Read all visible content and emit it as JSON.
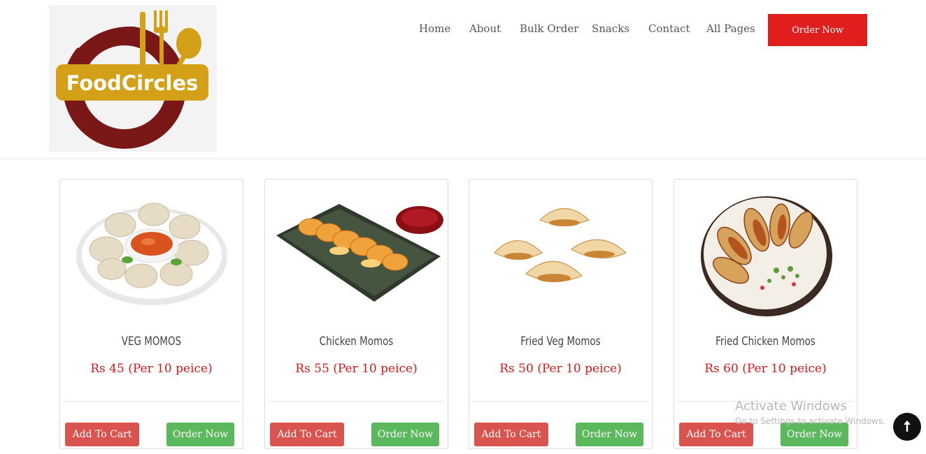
{
  "brand": {
    "logo_text": "FoodCircles",
    "colors": {
      "maroon": "#7a1717",
      "gold": "#d4a017"
    }
  },
  "nav": {
    "links": [
      "Home",
      "About",
      "Bulk Order",
      "Snacks",
      "Contact",
      "All Pages"
    ],
    "order_label": "Order Now",
    "order_color": "#e11e1e"
  },
  "products": [
    {
      "name": "VEG MOMOS",
      "price": "Rs 45 (Per 10 peice)",
      "image": "veg-momos-plate",
      "cart_label": "Add To Cart",
      "order_label": "Order Now"
    },
    {
      "name": "Chicken Momos",
      "price": "Rs 55 (Per 10 peice)",
      "image": "chicken-momos-tray",
      "cart_label": "Add To Cart",
      "order_label": "Order Now"
    },
    {
      "name": "Fried Veg Momos",
      "price": "Rs 50 (Per 10 peice)",
      "image": "fried-veg-momos",
      "cart_label": "Add To Cart",
      "order_label": "Order Now"
    },
    {
      "name": "Fried Chicken Momos",
      "price": "Rs 60 (Per 10 peice)",
      "image": "fried-chicken-momos-plate",
      "cart_label": "Add To Cart",
      "order_label": "Order Now"
    }
  ],
  "colors": {
    "price": "#d81818",
    "cart_button": "#d9534f",
    "order_button": "#5cb85c"
  },
  "watermark": {
    "title": "Activate Windows",
    "subtitle": "Go to Settings to activate Windows."
  },
  "scroll_top": {
    "icon": "arrow-up-icon"
  }
}
